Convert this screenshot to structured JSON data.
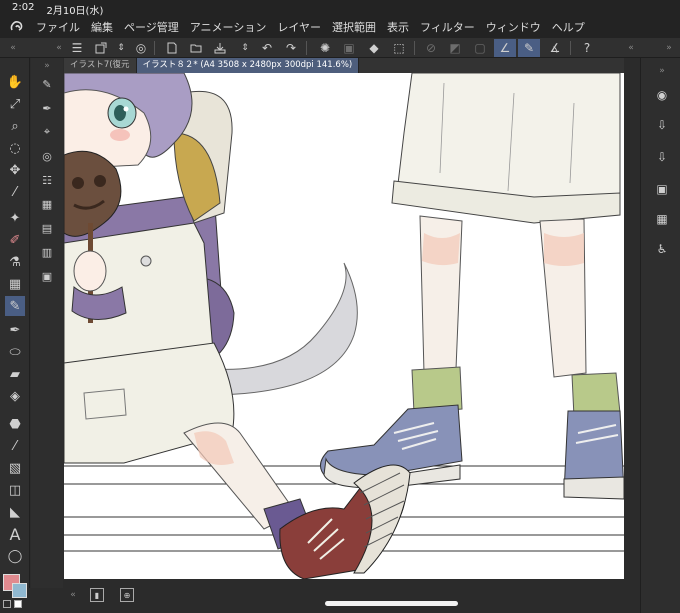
{
  "status": {
    "time": "2:02",
    "date": "2月10日(水)"
  },
  "menu": [
    "ファイル",
    "編集",
    "ページ管理",
    "アニメーション",
    "レイヤー",
    "選択範囲",
    "表示",
    "フィルター",
    "ウィンドウ",
    "ヘルプ"
  ],
  "tabs": [
    {
      "label": "イラスト7(復元",
      "active": false
    },
    {
      "label": "イラスト８２* (A4 3508 x 2480px 300dpi 141.6%)",
      "active": true
    }
  ],
  "colors": {
    "main": "#e08a8f",
    "sub": "#90b8d0",
    "accent": "#4a5e84"
  },
  "toolbar": {
    "icons": [
      "menu-icon",
      "new-icon",
      "open-icon",
      "save-icon",
      "undo-icon",
      "redo-icon",
      "loading-icon",
      "fill-icon",
      "transform-icon",
      "ruler-icon",
      "pen-ruler-icon",
      "help-icon"
    ]
  },
  "left_tools": [
    "hand-icon",
    "zoom-icon",
    "magnify-icon",
    "lasso-icon",
    "move-icon",
    "eyedropper-icon",
    "wand-icon",
    "pen-icon",
    "eraser-icon",
    "airbrush-icon",
    "pencil-icon",
    "brush-icon",
    "blend-icon",
    "fill-icon",
    "gradient-icon",
    "figure-icon",
    "frame-icon",
    "text-icon",
    "balloon-icon"
  ],
  "right_tools": [
    "navigator-icon",
    "import-icon",
    "export-icon",
    "layer-icon",
    "material-icon",
    "accessibility-icon"
  ]
}
